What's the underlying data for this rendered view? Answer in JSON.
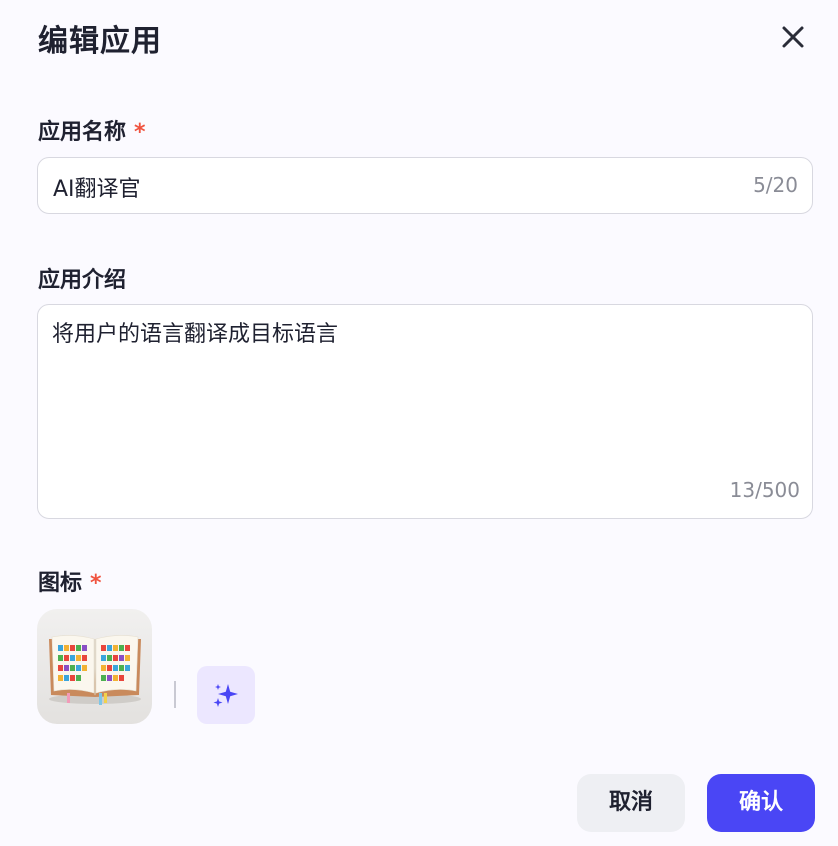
{
  "dialog": {
    "title": "编辑应用",
    "close_icon": "close-icon"
  },
  "name_field": {
    "label": "应用名称",
    "required_mark": "*",
    "value": "AI翻译官",
    "counter": "5/20"
  },
  "desc_field": {
    "label": "应用介绍",
    "value": "将用户的语言翻译成目标语言",
    "counter": "13/500"
  },
  "icon_field": {
    "label": "图标",
    "required_mark": "*",
    "thumbnail_icon": "open-book-icon",
    "ai_generate_icon": "sparkle-icon"
  },
  "footer": {
    "cancel_label": "取消",
    "confirm_label": "确认"
  },
  "colors": {
    "accent": "#4a46f5",
    "required": "#f0533f",
    "ai_button_bg": "#ece7ff"
  }
}
